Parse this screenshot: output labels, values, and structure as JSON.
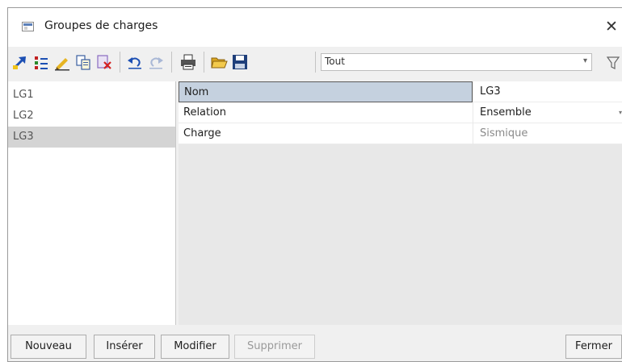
{
  "window": {
    "title": "Groupes de charges"
  },
  "toolbar": {
    "icons": [
      "arrow-new-icon",
      "split-icon",
      "pencil-icon",
      "copy-icon",
      "delete-icon",
      "undo-icon",
      "redo-icon",
      "print-icon",
      "open-folder-icon",
      "save-icon"
    ],
    "filter": {
      "selected": "Tout"
    }
  },
  "list": {
    "items": [
      "LG1",
      "LG2",
      "LG3"
    ],
    "selected": "LG3"
  },
  "properties": {
    "rows": [
      {
        "name": "Nom",
        "value": "LG3"
      },
      {
        "name": "Relation",
        "value": "Ensemble"
      },
      {
        "name": "Charge",
        "value": "Sismique"
      }
    ]
  },
  "buttons": {
    "new": "Nouveau",
    "insert": "Insérer",
    "modify": "Modifier",
    "delete": "Supprimer",
    "close": "Fermer"
  }
}
